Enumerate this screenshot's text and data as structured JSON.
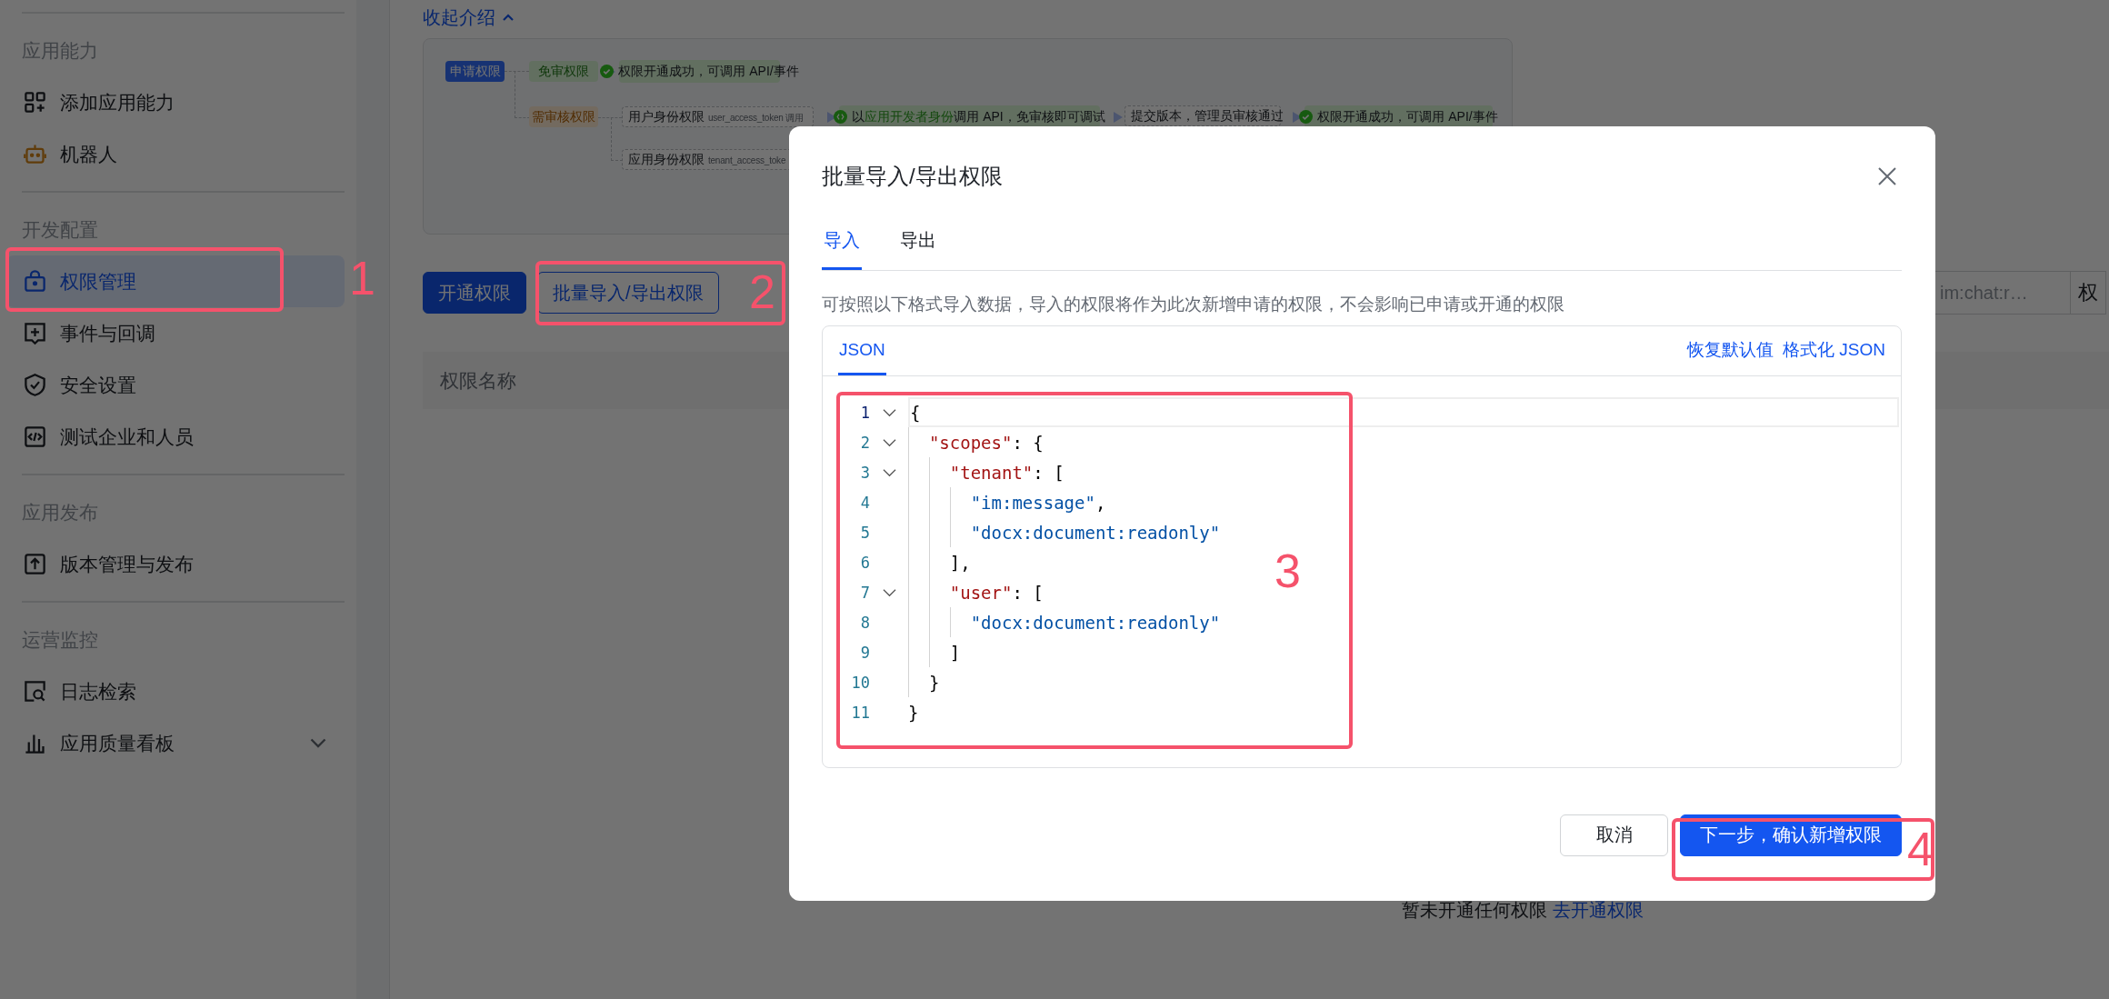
{
  "sidebar": {
    "sections": [
      {
        "title": "应用能力",
        "items": [
          {
            "label": "添加应用能力",
            "selected": false
          },
          {
            "label": "机器人",
            "selected": false
          }
        ]
      },
      {
        "title": "开发配置",
        "items": [
          {
            "label": "权限管理",
            "selected": true
          },
          {
            "label": "事件与回调",
            "selected": false
          },
          {
            "label": "安全设置",
            "selected": false
          },
          {
            "label": "测试企业和人员",
            "selected": false
          }
        ]
      },
      {
        "title": "应用发布",
        "items": [
          {
            "label": "版本管理与发布",
            "selected": false
          }
        ]
      },
      {
        "title": "运营监控",
        "items": [
          {
            "label": "日志检索",
            "selected": false
          },
          {
            "label": "应用质量看板",
            "selected": false,
            "expanded": false
          }
        ]
      }
    ]
  },
  "intro": {
    "toggle": "收起介绍",
    "expanded": true,
    "diagram": {
      "root": "申请权限",
      "branches": [
        {
          "label": "免审权限",
          "kind": "free",
          "steps": [
            {
              "kind": "result",
              "text": "权限开通成功，可调用 API/事件"
            }
          ]
        },
        {
          "label": "需审核权限",
          "kind": "review",
          "paths": [
            {
              "label": "用户身份权限",
              "token": "user_access_token 调用",
              "steps": [
                {
                  "kind": "debug",
                  "parts": [
                    "以",
                    "应用开发者身份",
                    "调用 API，免审核即可调试"
                  ]
                },
                {
                  "kind": "plain",
                  "parts": [
                    "提交版本，管理员审核通过"
                  ]
                },
                {
                  "kind": "result",
                  "text": "权限开通成功，可调用 API/事件"
                }
              ]
            },
            {
              "label": "应用身份权限",
              "token": "tenant_access_toke"
            }
          ]
        }
      ]
    }
  },
  "toolbar": {
    "buttons": [
      {
        "label": "开通权限",
        "kind": "primary"
      },
      {
        "label": "批量导入/导出权限",
        "kind": "outline"
      }
    ],
    "search": {
      "placeholder": "im:chat:r…"
    },
    "filter": {
      "value": "权"
    }
  },
  "table": {
    "columns": [
      "权限名称"
    ],
    "empty": {
      "message": "暂未开通任何权限",
      "link": "去开通权限"
    }
  },
  "dialog": {
    "title": "批量导入/导出权限",
    "tabs": [
      {
        "label": "导入",
        "selected": true
      },
      {
        "label": "导出",
        "selected": false
      }
    ],
    "description": "可按照以下格式导入数据，导入的权限将作为此次新增申请的权限，不会影响已申请或开通的权限",
    "editor": {
      "tabs": [
        {
          "label": "JSON",
          "selected": true
        }
      ],
      "links": [
        "恢复默认值",
        "格式化 JSON"
      ],
      "lines": [
        {
          "number": "1",
          "foldable": true,
          "current": true,
          "tokens": [
            {
              "kind": "punct",
              "text": "{"
            }
          ]
        },
        {
          "number": "2",
          "foldable": true,
          "current": false,
          "tokens": [
            {
              "kind": "key",
              "text": "  \"scopes\""
            },
            {
              "kind": "punct",
              "text": ": {"
            }
          ]
        },
        {
          "number": "3",
          "foldable": true,
          "current": false,
          "tokens": [
            {
              "kind": "key",
              "text": "    \"tenant\""
            },
            {
              "kind": "punct",
              "text": ": ["
            }
          ]
        },
        {
          "number": "4",
          "foldable": false,
          "current": false,
          "tokens": [
            {
              "kind": "string",
              "text": "      \"im:message\""
            },
            {
              "kind": "punct",
              "text": ","
            }
          ]
        },
        {
          "number": "5",
          "foldable": false,
          "current": false,
          "tokens": [
            {
              "kind": "string",
              "text": "      \"docx:document:readonly\""
            }
          ]
        },
        {
          "number": "6",
          "foldable": false,
          "current": false,
          "tokens": [
            {
              "kind": "punct",
              "text": "    ],"
            }
          ]
        },
        {
          "number": "7",
          "foldable": true,
          "current": false,
          "tokens": [
            {
              "kind": "key",
              "text": "    \"user\""
            },
            {
              "kind": "punct",
              "text": ": ["
            }
          ]
        },
        {
          "number": "8",
          "foldable": false,
          "current": false,
          "tokens": [
            {
              "kind": "string",
              "text": "      \"docx:document:readonly\""
            }
          ]
        },
        {
          "number": "9",
          "foldable": false,
          "current": false,
          "tokens": [
            {
              "kind": "punct",
              "text": "    ]"
            }
          ]
        },
        {
          "number": "10",
          "foldable": false,
          "current": false,
          "tokens": [
            {
              "kind": "punct",
              "text": "  }"
            }
          ]
        },
        {
          "number": "11",
          "foldable": false,
          "current": false,
          "tokens": [
            {
              "kind": "punct",
              "text": "}"
            }
          ]
        }
      ]
    },
    "buttons": [
      {
        "label": "取消",
        "kind": "secondary"
      },
      {
        "label": "下一步，确认新增权限",
        "kind": "primary"
      }
    ]
  },
  "annotations": [
    {
      "number": "1"
    },
    {
      "number": "2"
    },
    {
      "number": "3"
    },
    {
      "number": "4"
    }
  ]
}
